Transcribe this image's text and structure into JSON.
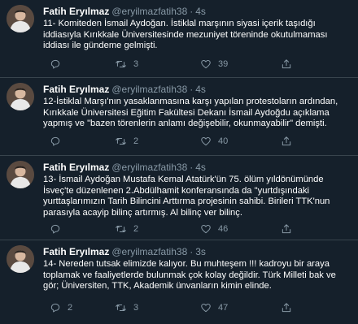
{
  "tweets": [
    {
      "name": "Fatih Eryılmaz",
      "handle": "@eryilmazfatih38",
      "dot": "·",
      "time": "4s",
      "text": "11- Komiteden İsmail Aydoğan. İstiklal marşının siyasi içerik taşıdığı iddiasıyla Kırıkkale Üniversitesinde mezuniyet töreninde okutulmaması iddiası ile gündeme gelmişti.",
      "replies": "",
      "retweets": "3",
      "likes": "39"
    },
    {
      "name": "Fatih Eryılmaz",
      "handle": "@eryilmazfatih38",
      "dot": "·",
      "time": "4s",
      "text": "12-İstiklal Marşı'nın yasaklanmasına karşı yapılan protestoların ardından, Kırıkkale Üniversitesi Eğitim Fakültesi Dekanı İsmail Aydoğdu açıklama yapmış ve \"bazen törenlerin anlamı değişebilir, okunmayabilir\" demişti.",
      "replies": "",
      "retweets": "2",
      "likes": "40"
    },
    {
      "name": "Fatih Eryılmaz",
      "handle": "@eryilmazfatih38",
      "dot": "·",
      "time": "4s",
      "text": "13- İsmail Aydoğan Mustafa Kemal Atatürk'ün 75. ölüm yıldönümünde İsveç'te düzenlenen 2.Abdülhamit konferansında da \"yurtdışındaki yurttaşlarımızın Tarih Bilincini Arttırma projesinin sahibi. Birileri TTK'nun parasıyla acayip bilinç artırmış. Al bilinç ver bilinç.",
      "replies": "",
      "retweets": "2",
      "likes": "46"
    },
    {
      "name": "Fatih Eryılmaz",
      "handle": "@eryilmazfatih38",
      "dot": "·",
      "time": "3s",
      "text": "14- Nereden tutsak elimizde kalıyor. Bu muhteşem !!! kadroyu bir araya toplamak ve faaliyetlerde bulunmak çok kolay değildir. Türk Milleti bak ve gör; Üniversiten, TTK, Akademik ünvanların kimin elinde.",
      "replies": "2",
      "retweets": "3",
      "likes": "47"
    }
  ],
  "icons": {
    "reply": "reply-icon",
    "retweet": "retweet-icon",
    "like": "heart-icon",
    "share": "share-icon"
  },
  "colors": {
    "background": "#15202b",
    "divider": "#38444d",
    "secondary_text": "#8899a6"
  }
}
